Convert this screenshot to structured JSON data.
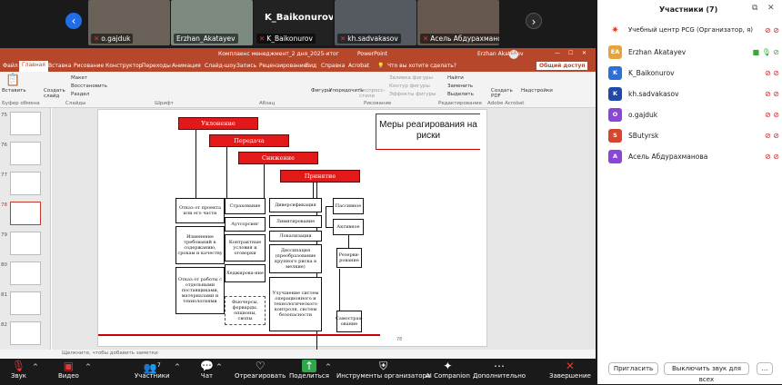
{
  "video_strip": {
    "participants": [
      {
        "name": "o.gajduk"
      },
      {
        "name": "Erzhan_Akatayev"
      },
      {
        "name": "K_Baikonurov"
      },
      {
        "name": "kh.sadvakasov"
      },
      {
        "name": "Асель Абдурахманова"
      }
    ],
    "speaker_big_name": "K_Baikonurov"
  },
  "ppt": {
    "title_file": "Комплаенс менеджмент_2 дня_2025-итог",
    "title_app": "PowerPoint",
    "title_user": "Erzhan Akatayev",
    "title_user_initials": "EA",
    "menu": [
      "Файл",
      "Главная",
      "Вставка",
      "Рисование",
      "Конструктор",
      "Переходы",
      "Анимация",
      "Слайд-шоу",
      "Запись",
      "Рецензирование",
      "Вид",
      "Справка",
      "Acrobat"
    ],
    "search_hint": "Что вы хотите сделать?",
    "share_label": "Общий доступ",
    "ribbon": {
      "paste": "Вставить",
      "clipboard": "Буфер обмена",
      "new_slide": "Создать слайд",
      "layout": "Макет",
      "reset": "Восстановить",
      "section": "Раздел",
      "slides": "Слайды",
      "font": "Шрифт",
      "paragraph": "Абзац",
      "shapes": "Фигуры",
      "arrange": "Упорядочить",
      "quick_styles": "Экспресс-стили",
      "shape_fill": "Заливка фигуры",
      "shape_outline": "Контур фигуры",
      "shape_effects": "Эффекты фигуры",
      "drawing": "Рисование",
      "find": "Найти",
      "replace": "Заменить",
      "select": "Выделить",
      "editing": "Редактирование",
      "create_pdf": "Создать PDF",
      "adobe": "Adobe Acrobat",
      "designer": "Надстройки"
    },
    "thumb_numbers": [
      "75",
      "76",
      "77",
      "78",
      "79",
      "80",
      "81",
      "82"
    ],
    "notes_hint": "Щелкните, чтобы добавить заметки"
  },
  "slide": {
    "title": "Меры реагирования на риски",
    "red_boxes": [
      "Уклонение",
      "Передача",
      "Снижение",
      "Принятие"
    ],
    "col1": [
      "Отказ от проекта или его части",
      "Изменение требований к содержанию, срокам и качеству",
      "Отказ от работы с отдельными поставщиками, материалами и технологиями"
    ],
    "col2": [
      "Страхование",
      "Аутсорсинг",
      "Контрактные условия и оговорки",
      "Хеджирова-ние",
      "Фьючерсы, форварды, опционы, свопы"
    ],
    "col3": [
      "Диверсификация",
      "Лимитирование",
      "Локализация",
      "Диссипация (преобразование крупного риска в мелкие)",
      "Улучшение систем операционного и технологического контроля, систем безопасности"
    ],
    "col4": [
      "Пассивное",
      "Активное",
      "Резерви-рование",
      "Самострах-ование"
    ],
    "page_number": "78"
  },
  "participants_panel": {
    "title": "Участники (7)",
    "people": [
      {
        "initials": "",
        "name": "Учебный центр PCG (Организатор, я)",
        "color": "#ffffff"
      },
      {
        "initials": "EA",
        "name": "Erzhan Akatayev",
        "color": "#e8a33d"
      },
      {
        "initials": "K",
        "name": "K_Baikonurov",
        "color": "#2d6fd6"
      },
      {
        "initials": "K",
        "name": "kh.sadvakasov",
        "color": "#1f4aa8"
      },
      {
        "initials": "O",
        "name": "o.gajduk",
        "color": "#8a46d6"
      },
      {
        "initials": "S",
        "name": "SButyrsk",
        "color": "#d6452d"
      },
      {
        "initials": "А",
        "name": "Асель Абдурахманова",
        "color": "#8a46d6"
      }
    ],
    "invite_label": "Пригласить",
    "unmute_all_label": "Выключить звук для всех",
    "more_label": "..."
  },
  "toolbar": {
    "audio": "Звук",
    "video": "Видео",
    "participants": "Участники",
    "participants_count": "7",
    "chat": "Чат",
    "react": "Отреагировать",
    "share": "Поделиться",
    "host_tools": "Инструменты организатора",
    "ai": "AI Companion",
    "more": "Дополнительно",
    "end": "Завершение"
  }
}
